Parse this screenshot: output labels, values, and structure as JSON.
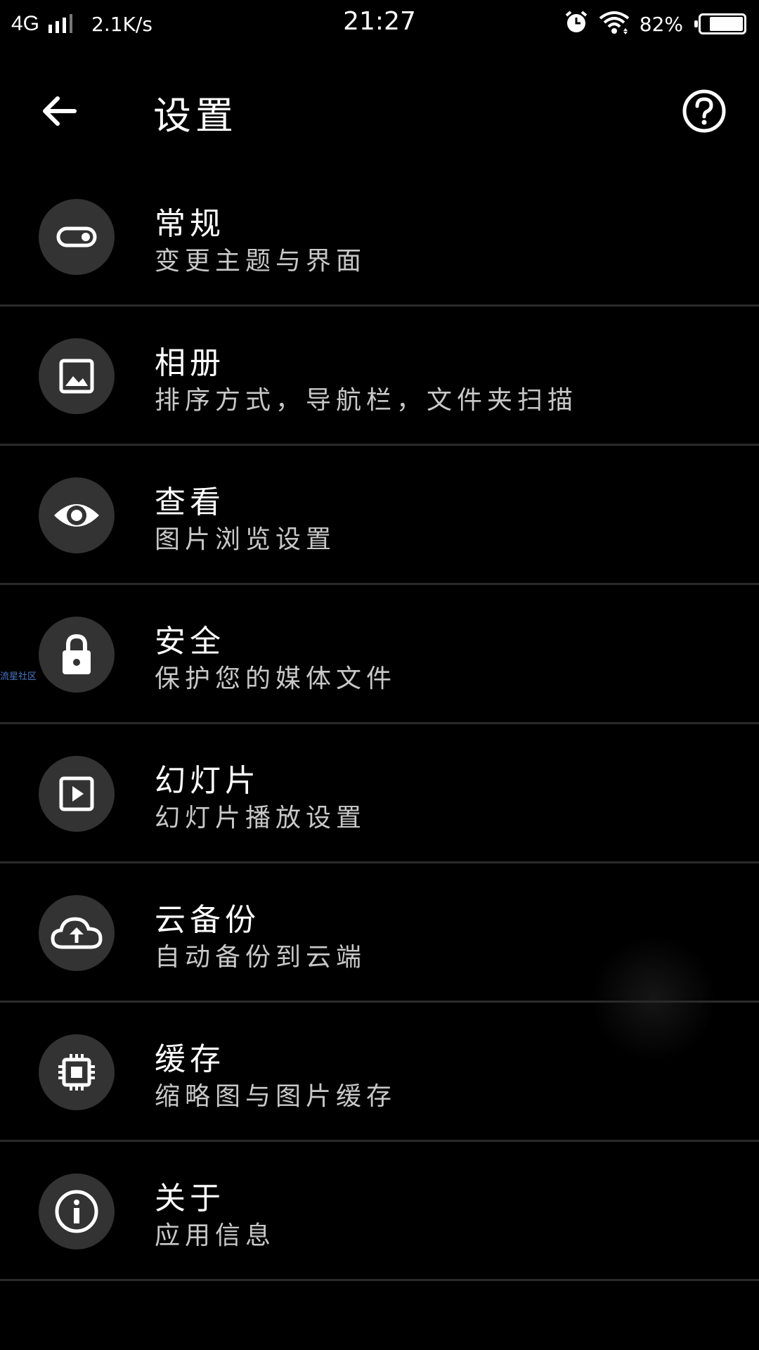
{
  "status_bar": {
    "network": "4G",
    "speed": "2.1K/s",
    "time": "21:27",
    "battery_percent_label": "82%",
    "battery_level": 0.82,
    "icons": [
      "signal-icon",
      "alarm-icon",
      "wifi-icon",
      "battery-icon"
    ]
  },
  "header": {
    "title": "设置",
    "back_icon": "arrow-left-icon",
    "help_icon": "help-circle-icon"
  },
  "settings": {
    "items": [
      {
        "title": "常规",
        "subtitle": "变更主题与界面",
        "icon": "toggle-icon"
      },
      {
        "title": "相册",
        "subtitle": "排序方式，导航栏，文件夹扫描",
        "icon": "image-icon"
      },
      {
        "title": "查看",
        "subtitle": "图片浏览设置",
        "icon": "eye-icon"
      },
      {
        "title": "安全",
        "subtitle": "保护您的媒体文件",
        "icon": "lock-icon"
      },
      {
        "title": "幻灯片",
        "subtitle": "幻灯片播放设置",
        "icon": "play-box-icon"
      },
      {
        "title": "云备份",
        "subtitle": "自动备份到云端",
        "icon": "cloud-upload-icon"
      },
      {
        "title": "缓存",
        "subtitle": "缩略图与图片缓存",
        "icon": "chip-icon"
      },
      {
        "title": "关于",
        "subtitle": "应用信息",
        "icon": "info-icon"
      }
    ]
  },
  "watermark": "流星社区",
  "colors": {
    "background": "#000000",
    "icon_circle": "#333333",
    "divider": "#2a2a2a",
    "text_primary": "#ffffff",
    "text_secondary": "#c8c8c8"
  }
}
